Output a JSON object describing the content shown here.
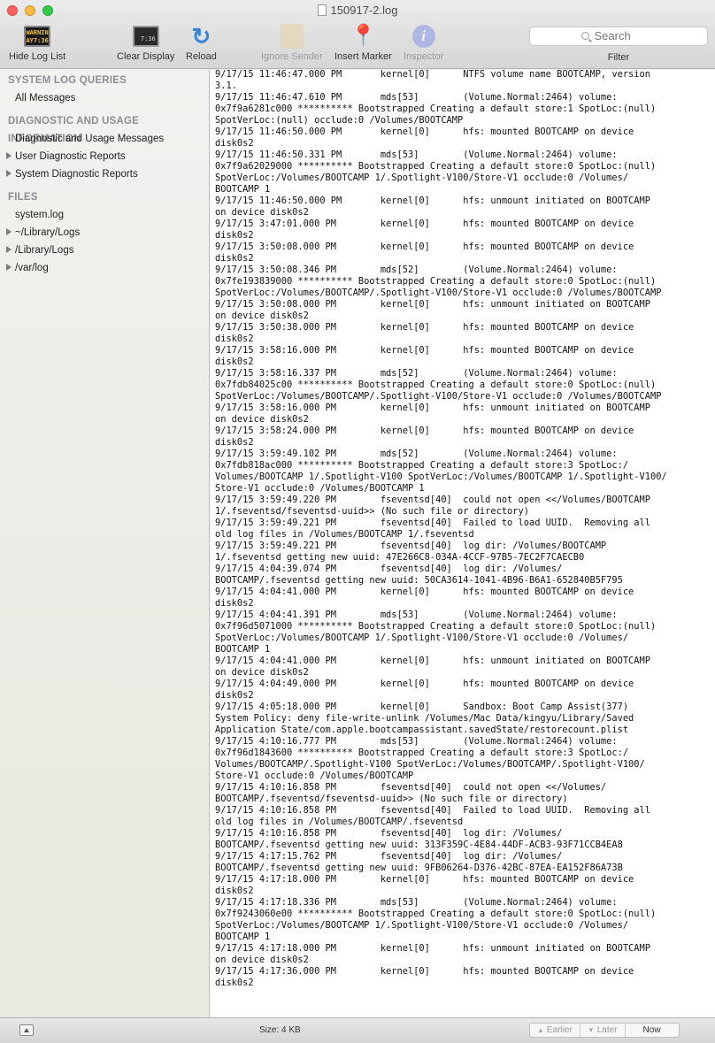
{
  "window": {
    "title": "150917-2.log"
  },
  "toolbar": {
    "hide_log_list": "Hide Log List",
    "console_icon_text": "WARNIN\nAY7:36",
    "clear_display": "Clear Display",
    "clear_icon_text": "7:36",
    "reload": "Reload",
    "ignore_sender": "Ignore Sender",
    "insert_marker": "Insert Marker",
    "inspector": "Inspector",
    "search_placeholder": "Search",
    "filter": "Filter"
  },
  "sidebar": {
    "section_queries": "SYSTEM LOG QUERIES",
    "all_messages": "All Messages",
    "section_diagnostic": "DIAGNOSTIC AND USAGE INFORMATION",
    "diag_messages": "Diagnostic and Usage Messages",
    "user_reports": "User Diagnostic Reports",
    "system_reports": "System Diagnostic Reports",
    "section_files": "FILES",
    "system_log": "system.log",
    "user_library_logs": "~/Library/Logs",
    "library_logs": "/Library/Logs",
    "var_log": "/var/log"
  },
  "log_text": "9/17/15 11:46:47.000 PM       kernel[0]      NTFS volume name BOOTCAMP, version\n3.1.\n9/17/15 11:46:47.610 PM       mds[53]        (Volume.Normal:2464) volume:\n0x7f9a6281c000 ********** Bootstrapped Creating a default store:1 SpotLoc:(null)\nSpotVerLoc:(null) occlude:0 /Volumes/BOOTCAMP\n9/17/15 11:46:50.000 PM       kernel[0]      hfs: mounted BOOTCAMP on device\ndisk0s2\n9/17/15 11:46:50.331 PM       mds[53]        (Volume.Normal:2464) volume:\n0x7f9a62029000 ********** Bootstrapped Creating a default store:0 SpotLoc:(null)\nSpotVerLoc:/Volumes/BOOTCAMP 1/.Spotlight-V100/Store-V1 occlude:0 /Volumes/\nBOOTCAMP 1\n9/17/15 11:46:50.000 PM       kernel[0]      hfs: unmount initiated on BOOTCAMP\non device disk0s2\n9/17/15 3:47:01.000 PM        kernel[0]      hfs: mounted BOOTCAMP on device\ndisk0s2\n9/17/15 3:50:08.000 PM        kernel[0]      hfs: mounted BOOTCAMP on device\ndisk0s2\n9/17/15 3:50:08.346 PM        mds[52]        (Volume.Normal:2464) volume:\n0x7fe193839000 ********** Bootstrapped Creating a default store:0 SpotLoc:(null)\nSpotVerLoc:/Volumes/BOOTCAMP/.Spotlight-V100/Store-V1 occlude:0 /Volumes/BOOTCAMP\n9/17/15 3:50:08.000 PM        kernel[0]      hfs: unmount initiated on BOOTCAMP\non device disk0s2\n9/17/15 3:50:38.000 PM        kernel[0]      hfs: mounted BOOTCAMP on device\ndisk0s2\n9/17/15 3:58:16.000 PM        kernel[0]      hfs: mounted BOOTCAMP on device\ndisk0s2\n9/17/15 3:58:16.337 PM        mds[52]        (Volume.Normal:2464) volume:\n0x7fdb84025c00 ********** Bootstrapped Creating a default store:0 SpotLoc:(null)\nSpotVerLoc:/Volumes/BOOTCAMP/.Spotlight-V100/Store-V1 occlude:0 /Volumes/BOOTCAMP\n9/17/15 3:58:16.000 PM        kernel[0]      hfs: unmount initiated on BOOTCAMP\non device disk0s2\n9/17/15 3:58:24.000 PM        kernel[0]      hfs: mounted BOOTCAMP on device\ndisk0s2\n9/17/15 3:59:49.102 PM        mds[52]        (Volume.Normal:2464) volume:\n0x7fdb818ac000 ********** Bootstrapped Creating a default store:3 SpotLoc:/\nVolumes/BOOTCAMP 1/.Spotlight-V100 SpotVerLoc:/Volumes/BOOTCAMP 1/.Spotlight-V100/\nStore-V1 occlude:0 /Volumes/BOOTCAMP 1\n9/17/15 3:59:49.220 PM        fseventsd[40]  could not open <</Volumes/BOOTCAMP\n1/.fseventsd/fseventsd-uuid>> (No such file or directory)\n9/17/15 3:59:49.221 PM        fseventsd[40]  Failed to load UUID.  Removing all\nold log files in /Volumes/BOOTCAMP 1/.fseventsd\n9/17/15 3:59:49.221 PM        fseventsd[40]  log dir: /Volumes/BOOTCAMP\n1/.fseventsd getting new uuid: 47E266C8-034A-4CCF-97B5-7EC2F7CAECB0\n9/17/15 4:04:39.074 PM        fseventsd[40]  log dir: /Volumes/\nBOOTCAMP/.fseventsd getting new uuid: 50CA3614-1041-4B96-B6A1-652840B5F795\n9/17/15 4:04:41.000 PM        kernel[0]      hfs: mounted BOOTCAMP on device\ndisk0s2\n9/17/15 4:04:41.391 PM        mds[53]        (Volume.Normal:2464) volume:\n0x7f96d5071000 ********** Bootstrapped Creating a default store:0 SpotLoc:(null)\nSpotVerLoc:/Volumes/BOOTCAMP 1/.Spotlight-V100/Store-V1 occlude:0 /Volumes/\nBOOTCAMP 1\n9/17/15 4:04:41.000 PM        kernel[0]      hfs: unmount initiated on BOOTCAMP\non device disk0s2\n9/17/15 4:04:49.000 PM        kernel[0]      hfs: mounted BOOTCAMP on device\ndisk0s2\n9/17/15 4:05:18.000 PM        kernel[0]      Sandbox: Boot Camp Assist(377)\nSystem Policy: deny file-write-unlink /Volumes/Mac Data/kingyu/Library/Saved\nApplication State/com.apple.bootcampassistant.savedState/restorecount.plist\n9/17/15 4:10:16.777 PM        mds[53]        (Volume.Normal:2464) volume:\n0x7f96d1843600 ********** Bootstrapped Creating a default store:3 SpotLoc:/\nVolumes/BOOTCAMP/.Spotlight-V100 SpotVerLoc:/Volumes/BOOTCAMP/.Spotlight-V100/\nStore-V1 occlude:0 /Volumes/BOOTCAMP\n9/17/15 4:10:16.858 PM        fseventsd[40]  could not open <</Volumes/\nBOOTCAMP/.fseventsd/fseventsd-uuid>> (No such file or directory)\n9/17/15 4:10:16.858 PM        fseventsd[40]  Failed to load UUID.  Removing all\nold log files in /Volumes/BOOTCAMP/.fseventsd\n9/17/15 4:10:16.858 PM        fseventsd[40]  log dir: /Volumes/\nBOOTCAMP/.fseventsd getting new uuid: 313F359C-4E84-44DF-ACB3-93F71CCB4EA8\n9/17/15 4:17:15.762 PM        fseventsd[40]  log dir: /Volumes/\nBOOTCAMP/.fseventsd getting new uuid: 9FB06264-D376-42BC-87EA-EA152F86A73B\n9/17/15 4:17:18.000 PM        kernel[0]      hfs: mounted BOOTCAMP on device\ndisk0s2\n9/17/15 4:17:18.336 PM        mds[53]        (Volume.Normal:2464) volume:\n0x7f9243060e00 ********** Bootstrapped Creating a default store:0 SpotLoc:(null)\nSpotVerLoc:/Volumes/BOOTCAMP 1/.Spotlight-V100/Store-V1 occlude:0 /Volumes/\nBOOTCAMP 1\n9/17/15 4:17:18.000 PM        kernel[0]      hfs: unmount initiated on BOOTCAMP\non device disk0s2\n9/17/15 4:17:36.000 PM        kernel[0]      hfs: mounted BOOTCAMP on device\ndisk0s2",
  "statusbar": {
    "size": "Size: 4 KB",
    "earlier": "Earlier",
    "later": "Later",
    "now": "Now"
  }
}
